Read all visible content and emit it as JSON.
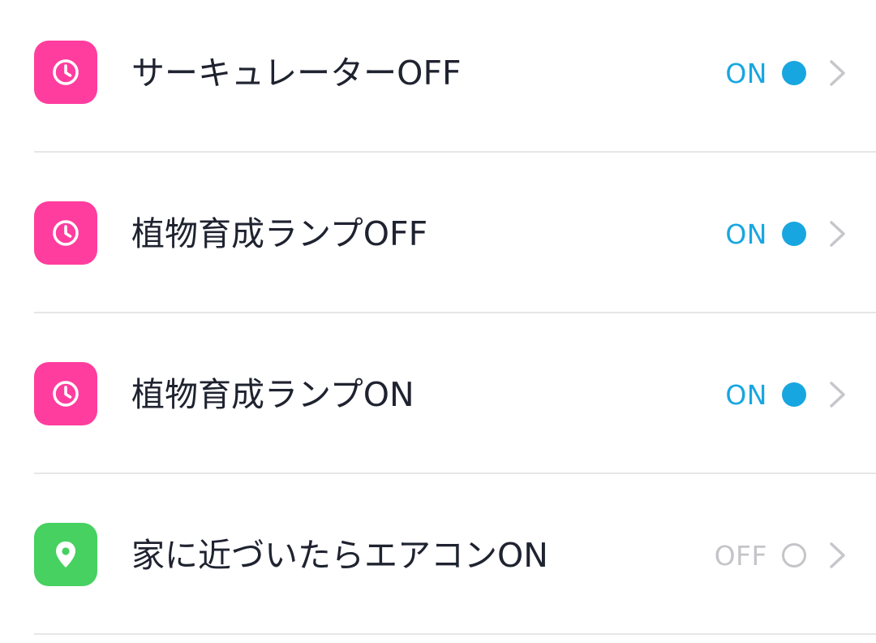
{
  "colors": {
    "timer_tile": "#ff3d9e",
    "location_tile": "#46d160",
    "on": "#18a6e0",
    "off": "#c4c4c9",
    "title": "#1f2330",
    "chevron": "#c6c6cb",
    "divider": "#e6e6e9"
  },
  "rows": [
    {
      "icon": "clock-icon",
      "tile": "timer",
      "title": "サーキュレーターOFF",
      "status": "ON",
      "enabled": true
    },
    {
      "icon": "clock-icon",
      "tile": "timer",
      "title": "植物育成ランプOFF",
      "status": "ON",
      "enabled": true
    },
    {
      "icon": "clock-icon",
      "tile": "timer",
      "title": "植物育成ランプON",
      "status": "ON",
      "enabled": true
    },
    {
      "icon": "location-pin-icon",
      "tile": "location",
      "title": "家に近づいたらエアコンON",
      "status": "OFF",
      "enabled": false
    }
  ]
}
